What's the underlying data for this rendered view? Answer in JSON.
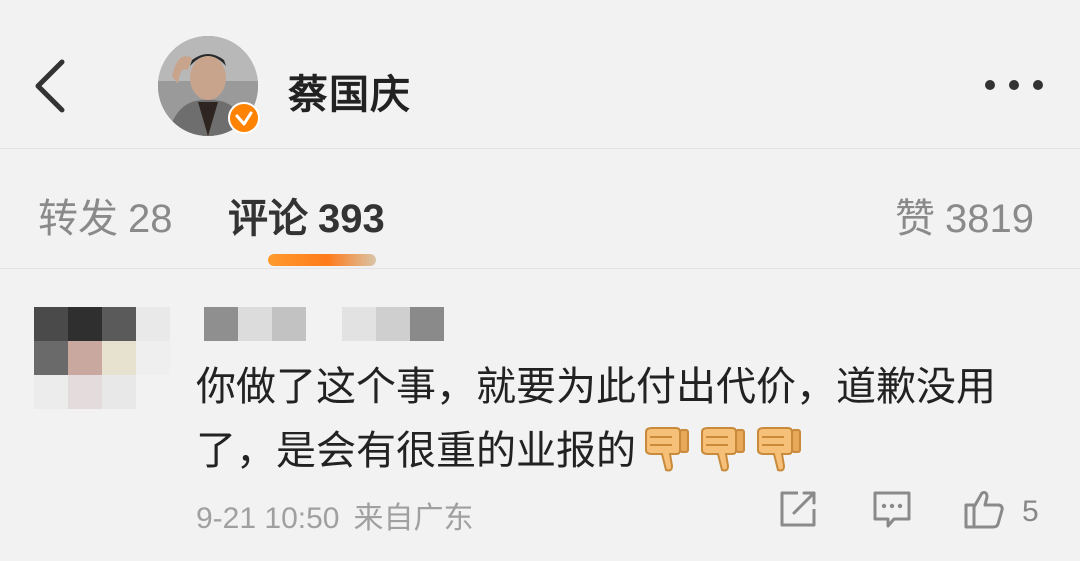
{
  "header": {
    "username": "蔡国庆",
    "back_icon": "chevron-left-icon",
    "more_icon": "more-horizontal-icon",
    "verified_icon": "verified-badge-icon",
    "accent_color": "#ff8200"
  },
  "tabs": {
    "repost": {
      "label": "转发",
      "count": "28"
    },
    "comment": {
      "label": "评论",
      "count": "393"
    },
    "likes": {
      "label": "赞",
      "count": "3819"
    }
  },
  "comment": {
    "text_line1": "你做了这个事，就要为此付出代价，道歉没用",
    "text_line2": "了，是会有很重的业报的",
    "emoji": [
      "thumbs-down-emoji",
      "thumbs-down-emoji",
      "thumbs-down-emoji"
    ],
    "time": "9-21 10:50",
    "source": "来自广东",
    "like_count": "5",
    "actions": [
      "share-icon",
      "reply-icon",
      "like-icon"
    ]
  }
}
